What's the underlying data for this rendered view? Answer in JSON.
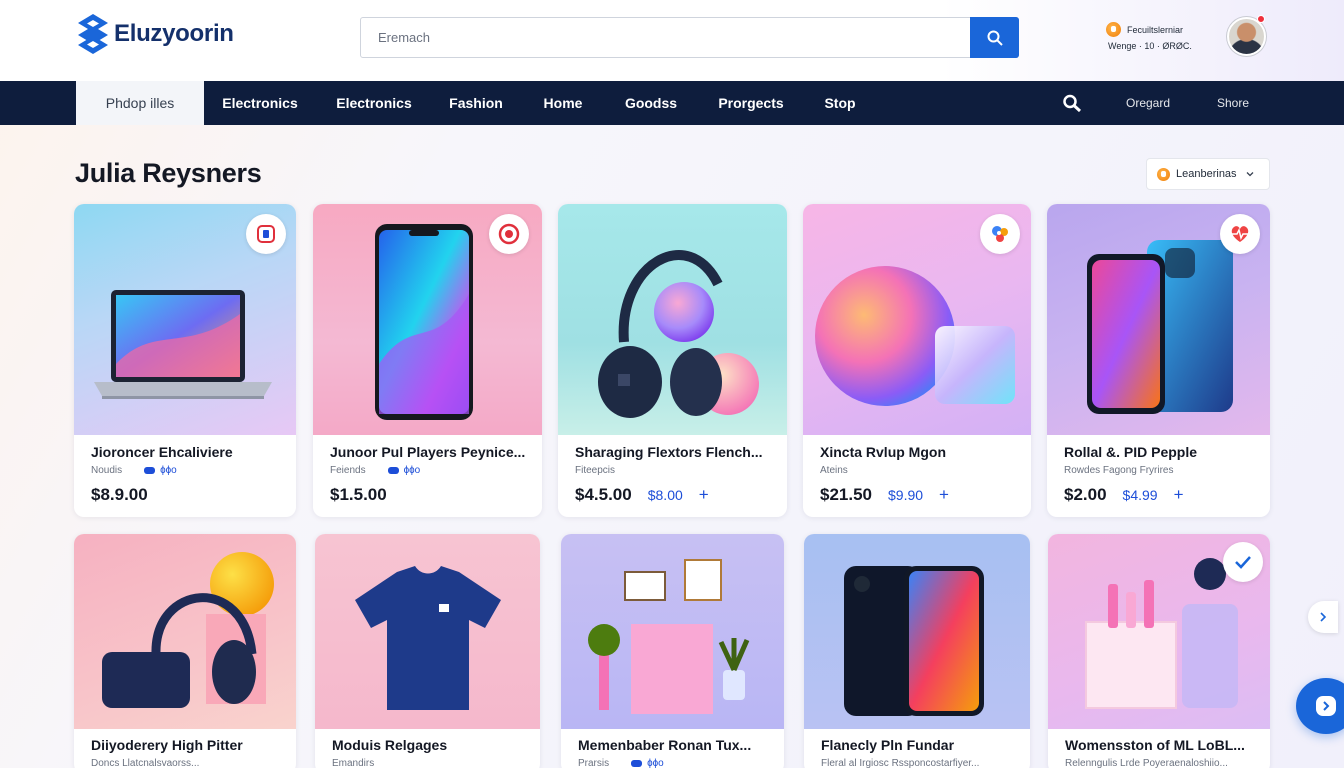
{
  "header": {
    "logo_text": "Eluzyoorin",
    "search_placeholder": "Eremach",
    "account_name": "Fecuiltslerniar",
    "account_meta": "Wenge · 10 · ØRØC."
  },
  "nav": {
    "items": [
      "Phdop illes",
      "Electronics",
      "Electronics",
      "Fashion",
      "Home",
      "Goodss",
      "Prorgects",
      "Stop"
    ],
    "right_items": [
      "Oregard",
      "Shore"
    ]
  },
  "page": {
    "title": "Julia Reysners",
    "sort_label": "Leanberinas"
  },
  "products_row1": [
    {
      "name": "Jioroncer Ehcaliviere",
      "meta": "Noudis",
      "tag": "ɸɸo",
      "price": "$8.9.00",
      "alt_price": ""
    },
    {
      "name": "Junoor Pul Players Peynice...",
      "meta": "Feiends",
      "tag": "ɸɸo",
      "price": "$1.5.00",
      "alt_price": ""
    },
    {
      "name": "Sharaging Flextors Flench...",
      "meta": "Fiteepcis",
      "tag": "",
      "price": "$4.5.00",
      "alt_price": "$8.00"
    },
    {
      "name": "Xincta Rvlup Mgon",
      "meta": "Ateins",
      "tag": "",
      "price": "$21.50",
      "alt_price": "$9.90"
    },
    {
      "name": "Rollal &. PID Pepple",
      "meta": "Rowdes Fagong Fryrires",
      "tag": "",
      "price": "$2.00",
      "alt_price": "$4.99"
    }
  ],
  "products_row2": [
    {
      "name": "Diiyoderery High Pitter",
      "meta": "Doncs Llatcnalsvaorss..."
    },
    {
      "name": "Moduis Relgages",
      "meta": "Emandirs"
    },
    {
      "name": "Memenbaber Ronan Tux...",
      "meta": "Prarsis",
      "tag": "ɸɸo"
    },
    {
      "name": "Flanecly Pln Fundar",
      "meta": "Fleral al Irgiosc Rssponcostarfiyer..."
    },
    {
      "name": "Womensston of ML LoBL...",
      "meta": "Relenngulis Lrde Poyeraenaloshiio..."
    }
  ],
  "colors": {
    "nav_bg": "#0e1d3d",
    "accent": "#1a66d9",
    "price_blue": "#1d4ed8"
  },
  "icons": [
    "logo-mark-icon",
    "search-icon",
    "coin-icon",
    "magnifier-icon",
    "chevron-down-icon",
    "plus-icon",
    "checkmark-icon",
    "chat-icon"
  ]
}
